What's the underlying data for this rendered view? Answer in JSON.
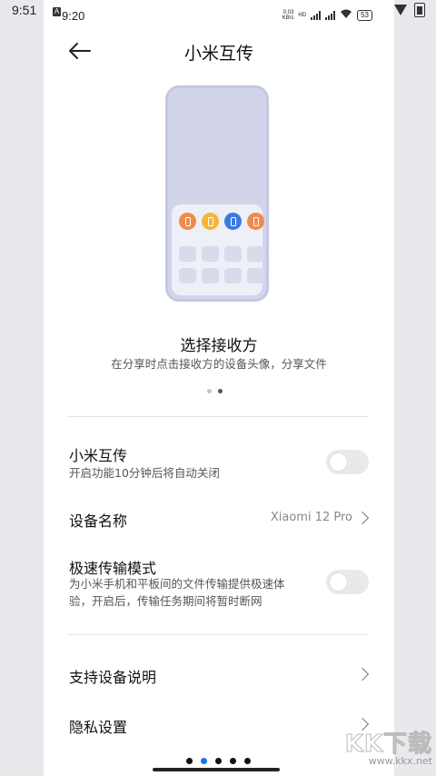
{
  "outer_status": {
    "time": "9:51"
  },
  "status": {
    "time": "9:20",
    "net_speed_top": "0.03",
    "net_speed_bottom": "KB/s",
    "network_tag": "HD",
    "battery": "53"
  },
  "header": {
    "title": "小米互传"
  },
  "hero": {
    "title": "选择接收方",
    "subtitle": "在分享时点击接收方的设备头像，分享文件",
    "page_indicator": {
      "count": 2,
      "active": 2
    },
    "device_colors": [
      "#f08a4b",
      "#f0b63a",
      "#3d7ae0",
      "#f08a4b"
    ]
  },
  "settings": {
    "transfer": {
      "title": "小米互传",
      "desc": "开启功能10分钟后将自动关闭",
      "enabled": false
    },
    "device_name": {
      "title": "设备名称",
      "value": "Xiaomi 12 Pro"
    },
    "fast_mode": {
      "title": "极速传输模式",
      "desc": "为小米手机和平板间的文件传输提供极速体验，开启后，传输任务期间将暂时断网",
      "enabled": false
    },
    "supported_devices": {
      "title": "支持设备说明"
    },
    "privacy": {
      "title": "隐私设置"
    }
  },
  "launcher_pages": {
    "count": 5,
    "active": 2
  },
  "watermark": {
    "logo": "KK下载",
    "url": "www.kkx.net"
  }
}
